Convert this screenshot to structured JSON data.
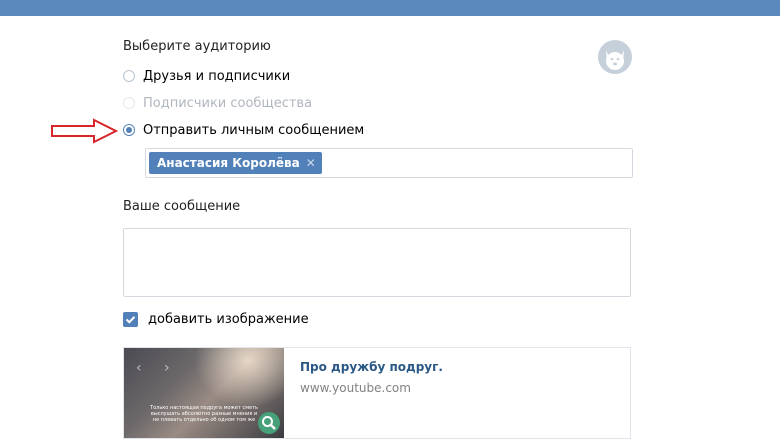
{
  "audience": {
    "title": "Выберите аудиторию",
    "options": [
      {
        "label": "Друзья и подписчики",
        "state": "unchecked"
      },
      {
        "label": "Подписчики сообщества",
        "state": "disabled"
      },
      {
        "label": "Отправить личным сообщением",
        "state": "checked"
      }
    ]
  },
  "recipient": {
    "token_label": "Анастасия Королёва",
    "remove_glyph": "✕"
  },
  "message": {
    "title": "Ваше сообщение",
    "value": ""
  },
  "add_image": {
    "label": "добавить изображение",
    "checked": true
  },
  "attachment": {
    "title": "Про дружбу подруг.",
    "url": "www.youtube.com",
    "caption": "Только настоящая подруга может сметь выслушать абсолютно разные мнения и не плевать отдельно об одном том же"
  },
  "icons": {
    "top_right": "dog-mascot-icon",
    "indicator": "arrow-right-icon",
    "zoom": "search-icon"
  },
  "colors": {
    "accent": "#5181b8",
    "header": "#5b88bd",
    "link": "#2a5885",
    "arrow": "#d9262b",
    "muted": "#828282"
  }
}
